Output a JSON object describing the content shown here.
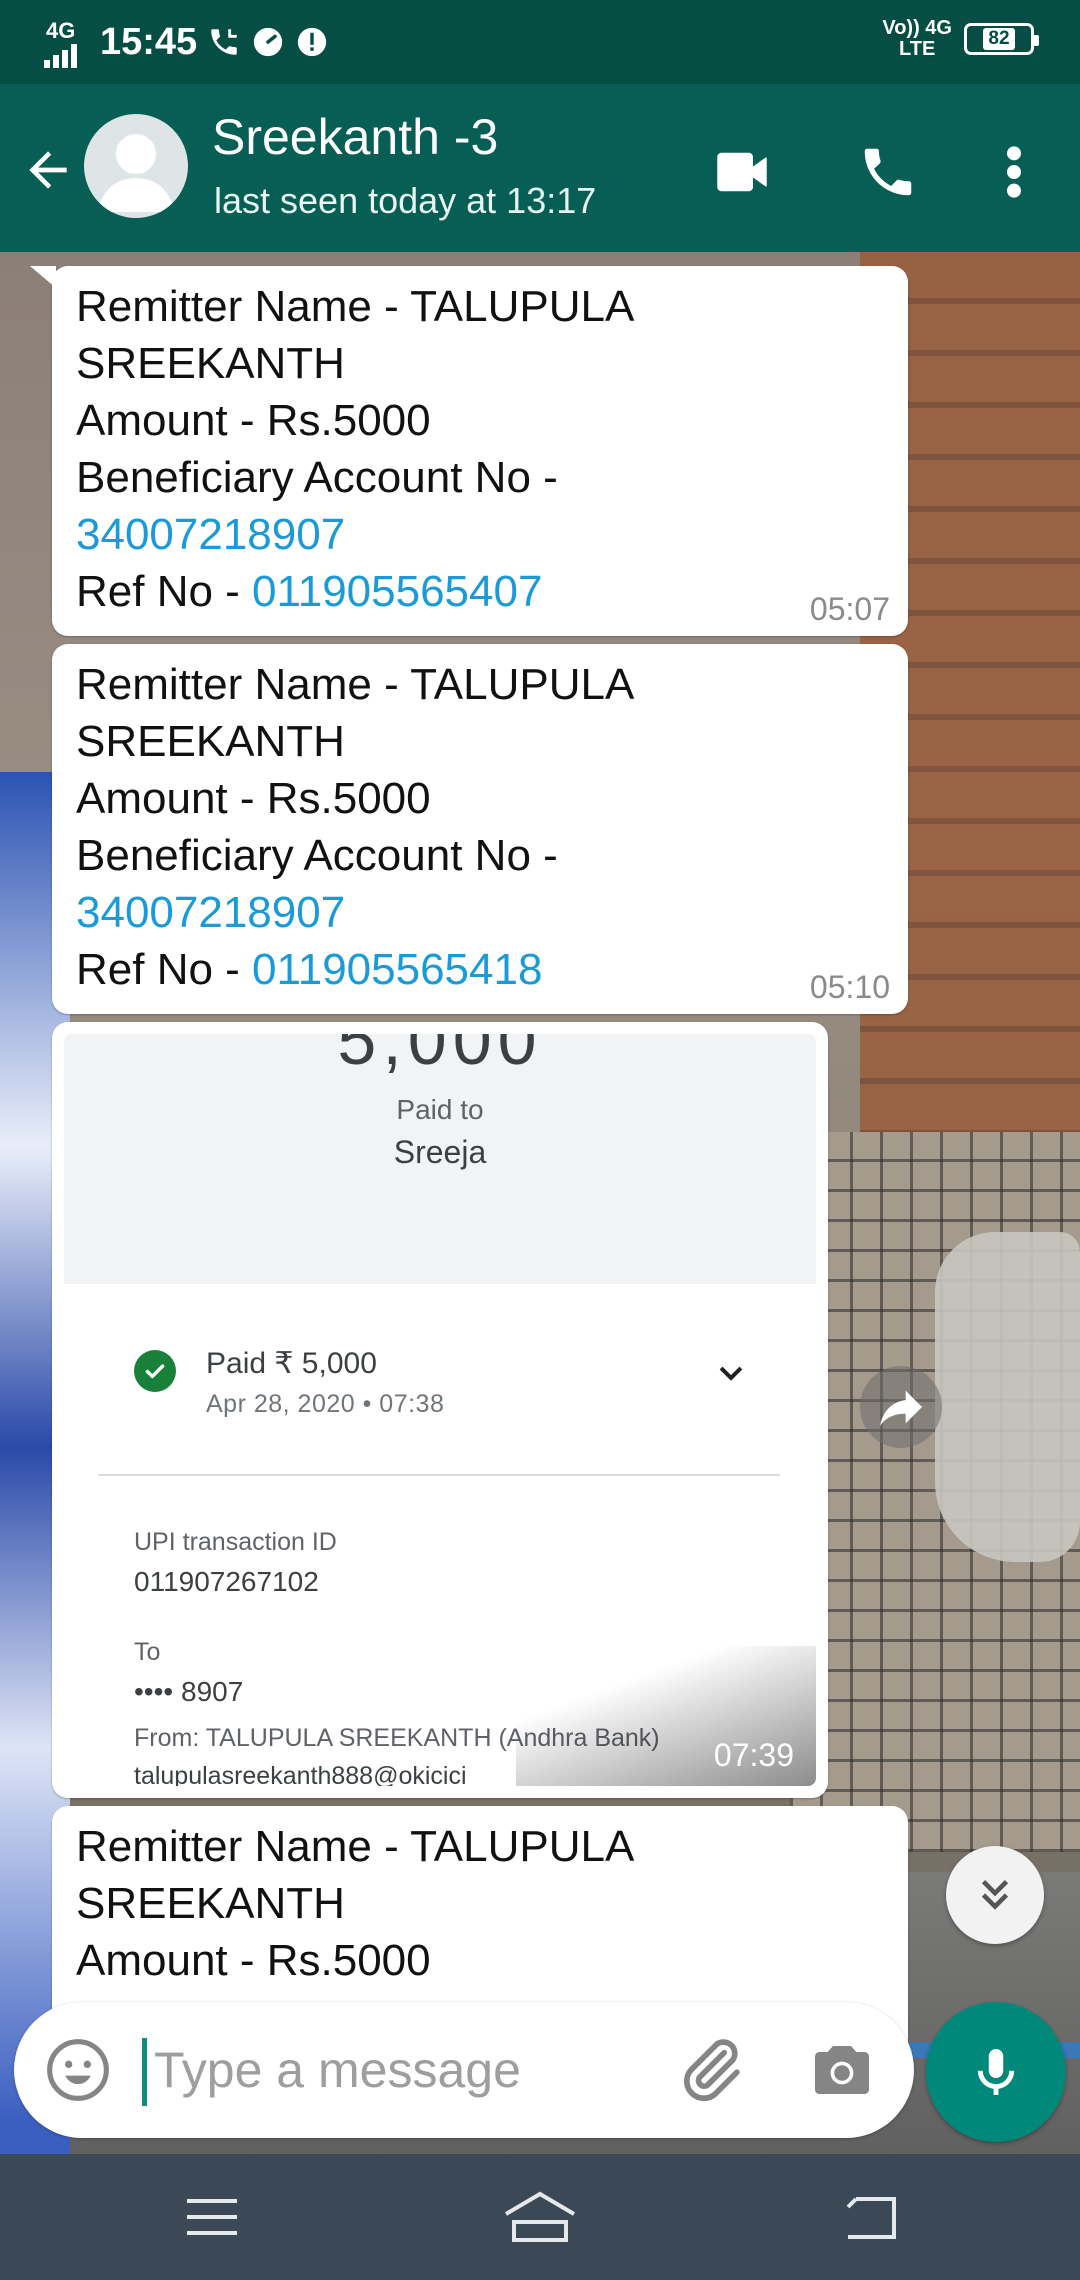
{
  "status_bar": {
    "network": "4G",
    "time": "15:45",
    "volte": "Vo)) 4G",
    "lte": "LTE",
    "battery": "82"
  },
  "header": {
    "contact_name": "Sreekanth -3",
    "last_seen": "last seen today at 13:17",
    "icons": [
      "back-arrow-icon",
      "avatar",
      "video-call-icon",
      "phone-icon",
      "more-options-icon"
    ]
  },
  "messages": [
    {
      "remitter": "Remitter Name - TALUPULA",
      "remitter_2": "SREEKANTH",
      "amount": "Amount - Rs.5000",
      "beneficiary_label": "Beneficiary Account No -",
      "account_no": "34007218907",
      "ref_label": "Ref No - ",
      "ref_no": "011905565407",
      "time": "05:07"
    },
    {
      "remitter": "Remitter Name - TALUPULA",
      "remitter_2": "SREEKANTH",
      "amount": "Amount - Rs.5000",
      "beneficiary_label": "Beneficiary Account No -",
      "account_no": "34007218907",
      "ref_label": "Ref No - ",
      "ref_no": "011905565418",
      "time": "05:10"
    }
  ],
  "image_message": {
    "amount_partial": "5,000",
    "paid_to_label": "Paid to",
    "payee": "Sreeja",
    "paid_status": "Paid ₹ 5,000",
    "date": "Apr 28, 2020 • 07:38",
    "upi_label": "UPI transaction ID",
    "upi_id": "011907267102",
    "to_label": "To",
    "to_value": "•••• 8907",
    "from": "From: TALUPULA SREEKANTH (Andhra Bank)",
    "email": "talupulasreekanth888@okicici",
    "time": "07:39"
  },
  "partial_message": {
    "remitter": "Remitter Name - TALUPULA",
    "remitter_2": "SREEKANTH",
    "amount": "Amount - Rs.5000"
  },
  "composer": {
    "placeholder": "Type a message"
  },
  "colors": {
    "header_bg": "#075e54",
    "status_bg": "#064d43",
    "link": "#1a9ad6",
    "mic_bg": "#00897b",
    "nav_bg": "#3a4955"
  }
}
